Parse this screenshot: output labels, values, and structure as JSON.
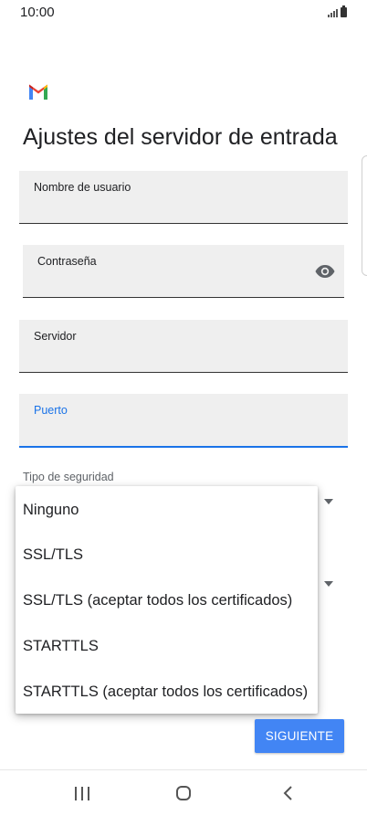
{
  "status_bar": {
    "time": "10:00"
  },
  "page": {
    "title": "Ajustes del servidor de entrada"
  },
  "form": {
    "username": {
      "label": "Nombre de usuario",
      "value": ""
    },
    "password": {
      "label": "Contraseña",
      "value": ""
    },
    "server": {
      "label": "Servidor",
      "value": ""
    },
    "port": {
      "label": "Puerto",
      "value": ""
    },
    "security": {
      "label": "Tipo de seguridad"
    }
  },
  "dropdown": {
    "options": [
      "Ninguno",
      "SSL/TLS",
      "SSL/TLS (aceptar todos los certificados)",
      "STARTTLS",
      "STARTTLS (aceptar todos los certificados)"
    ]
  },
  "actions": {
    "next_label": "SIGUIENTE"
  },
  "colors": {
    "accent": "#1a73e8",
    "button": "#4285f4",
    "field_bg": "#efefef"
  },
  "icons": {
    "logo": "gmail-logo-icon",
    "password_toggle": "eye-icon",
    "nav_recents": "recents-icon",
    "nav_home": "home-icon",
    "nav_back": "back-icon"
  }
}
